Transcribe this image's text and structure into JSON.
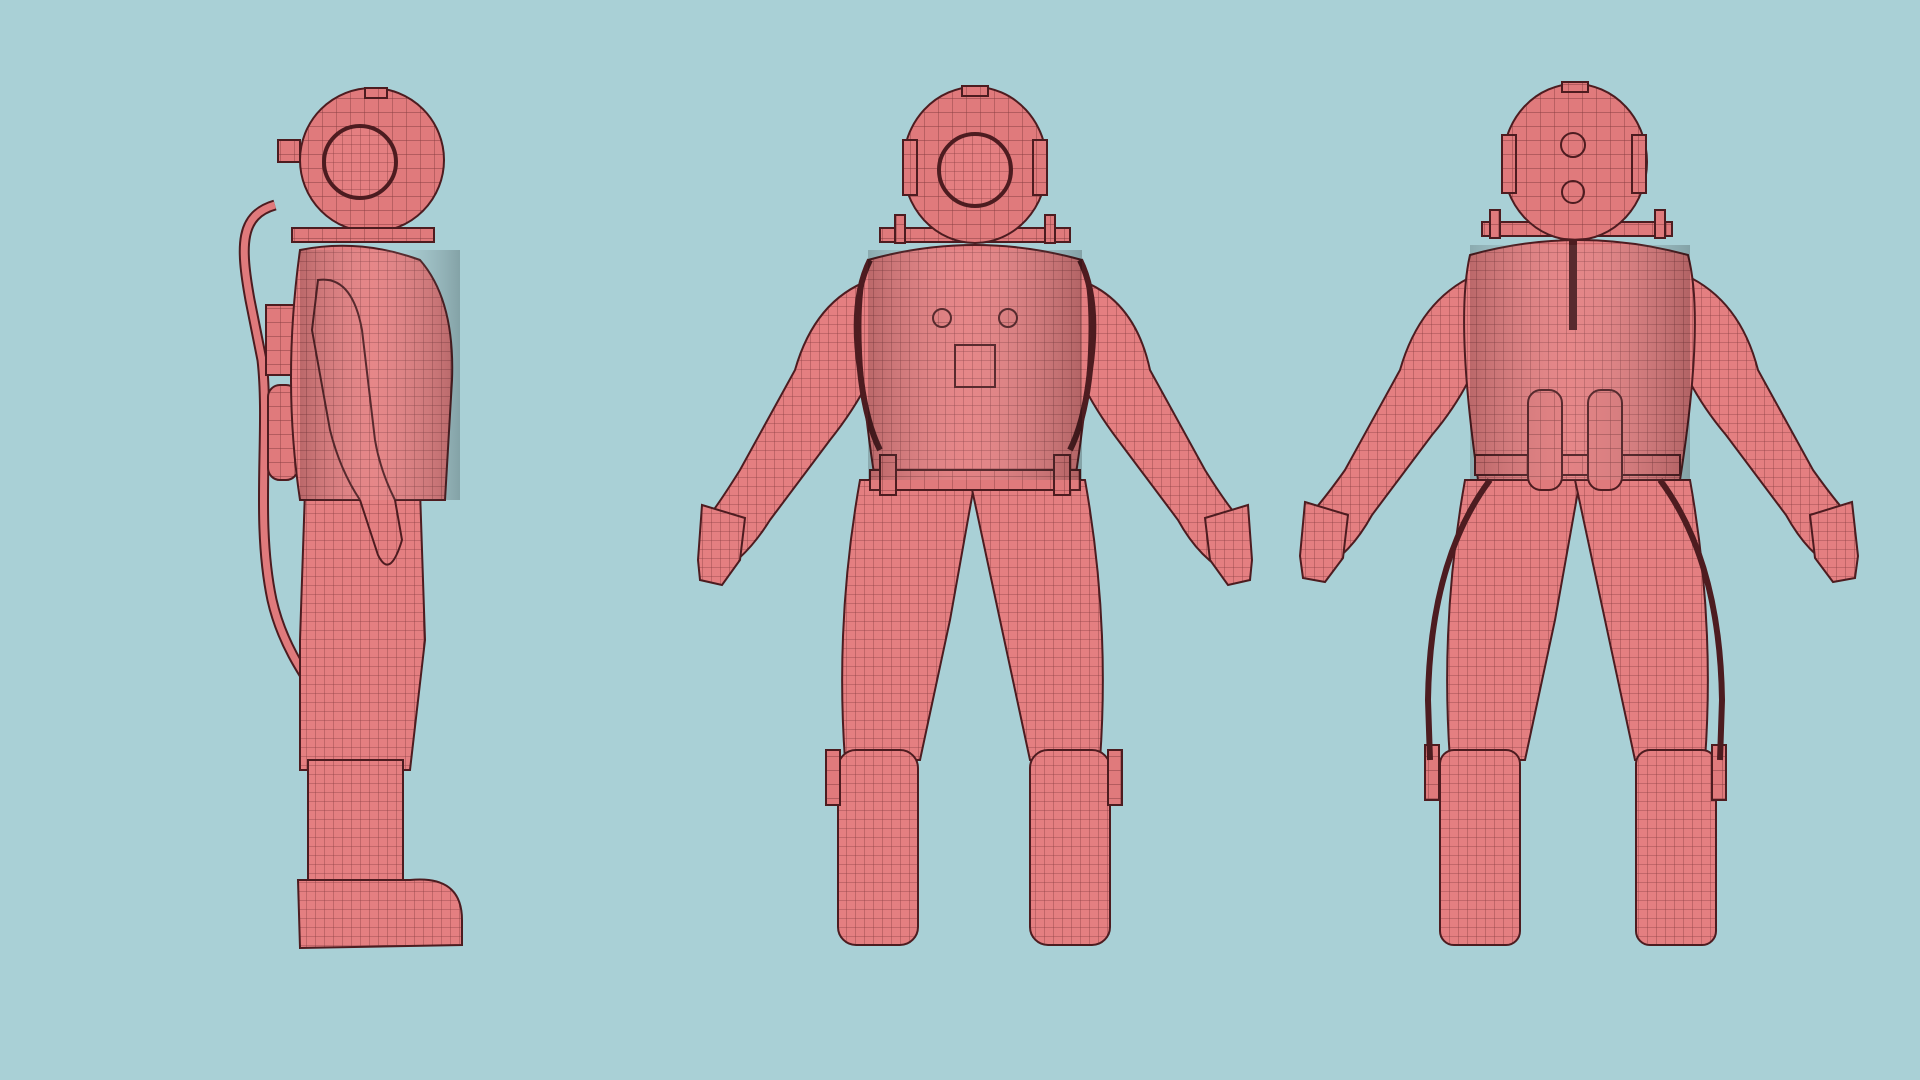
{
  "scene": {
    "background_color": "#a9d0d6",
    "model_color": "#e07a7c",
    "model_shade_color": "#c9585c",
    "wire_color": "#5a2226",
    "views": [
      {
        "name": "side-view",
        "subject": "diving-suit-model"
      },
      {
        "name": "front-view",
        "subject": "diving-suit-model"
      },
      {
        "name": "back-view",
        "subject": "diving-suit-model"
      }
    ]
  }
}
